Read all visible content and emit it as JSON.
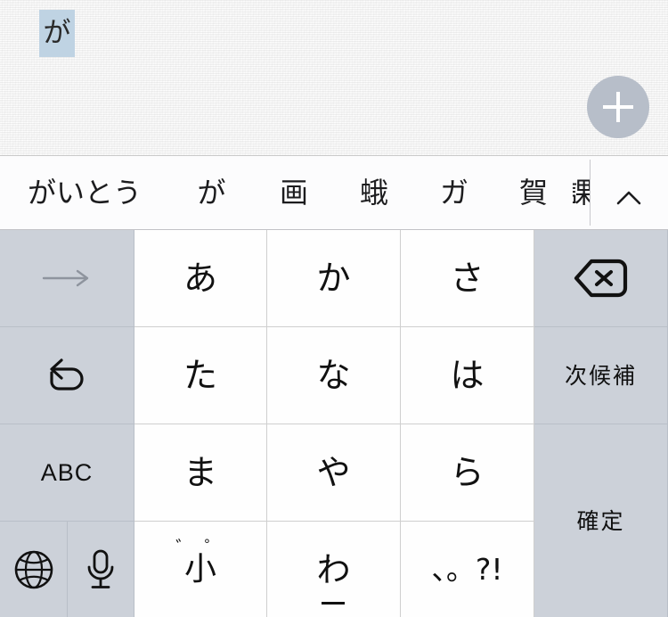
{
  "app": {
    "name": "japanese-ime-keyboard",
    "accent_selection_color": "#bfd3e3",
    "key_function_bg": "#ccd1d9",
    "key_char_bg": "#fefefe",
    "add_button_color": "#b7bec9"
  },
  "text_area": {
    "composing_text": "が",
    "add_button_label": "+",
    "add_button_icon": "plus-icon"
  },
  "suggestion_bar": {
    "candidates": [
      {
        "text": "がいとう"
      },
      {
        "text": "が"
      },
      {
        "text": "画"
      },
      {
        "text": "蛾"
      },
      {
        "text": "ガ"
      },
      {
        "text": "賀"
      },
      {
        "text": "課"
      }
    ],
    "expand_icon": "chevron-up-icon"
  },
  "keyboard": {
    "rows": [
      {
        "keys": [
          {
            "name": "cursor-right-key",
            "icon": "arrow-right-icon",
            "type": "function"
          },
          {
            "name": "kana-a-key",
            "label": "あ",
            "type": "char"
          },
          {
            "name": "kana-ka-key",
            "label": "か",
            "type": "char"
          },
          {
            "name": "kana-sa-key",
            "label": "さ",
            "type": "char"
          },
          {
            "name": "backspace-key",
            "icon": "backspace-icon",
            "type": "function"
          }
        ]
      },
      {
        "keys": [
          {
            "name": "undo-key",
            "icon": "undo-icon",
            "type": "function"
          },
          {
            "name": "kana-ta-key",
            "label": "た",
            "type": "char"
          },
          {
            "name": "kana-na-key",
            "label": "な",
            "type": "char"
          },
          {
            "name": "kana-ha-key",
            "label": "は",
            "type": "char"
          },
          {
            "name": "next-candidate-key",
            "label": "次候補",
            "type": "function"
          }
        ]
      },
      {
        "keys": [
          {
            "name": "abc-mode-key",
            "label": "ABC",
            "type": "function"
          },
          {
            "name": "kana-ma-key",
            "label": "ま",
            "type": "char"
          },
          {
            "name": "kana-ya-key",
            "label": "や",
            "type": "char"
          },
          {
            "name": "kana-ra-key",
            "label": "ら",
            "type": "char"
          },
          {
            "name": "confirm-key",
            "label": "確定",
            "type": "function"
          }
        ]
      },
      {
        "keys": [
          {
            "name": "globe-key",
            "icon": "globe-icon",
            "type": "function"
          },
          {
            "name": "dictation-key",
            "icon": "microphone-icon",
            "type": "function"
          },
          {
            "name": "small-kana-key",
            "label": "小",
            "marks": "゛ ゜",
            "type": "char"
          },
          {
            "name": "kana-wa-key",
            "label": "わ",
            "sub": "_",
            "type": "char"
          },
          {
            "name": "punctuation-key",
            "label": "、。?!",
            "type": "char"
          }
        ]
      }
    ]
  }
}
